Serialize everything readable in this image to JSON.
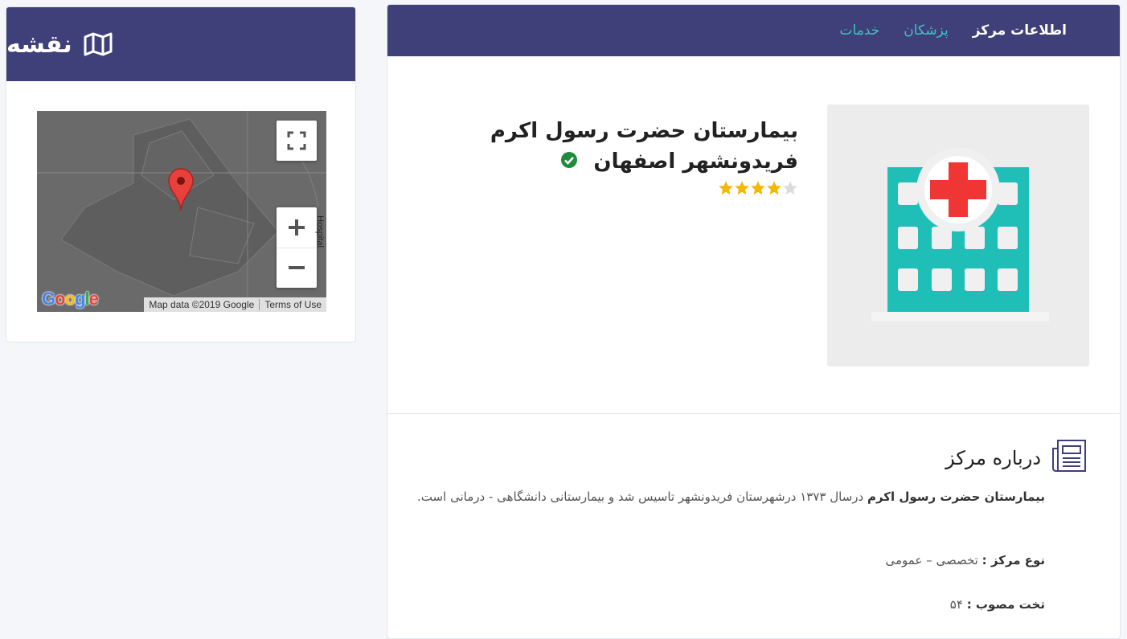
{
  "map_card": {
    "title": "نقشه",
    "attribution": "Map data ©2019 Google",
    "terms": "Terms of Use",
    "road_label": "Hospital",
    "google_logo": "Google"
  },
  "tabs": [
    {
      "label": "اطلاعات مرکز",
      "active": true
    },
    {
      "label": "پزشکان",
      "active": false
    },
    {
      "label": "خدمات",
      "active": false
    }
  ],
  "center": {
    "title": "بیمارستان حضرت رسول اکرم فریدونشهر اصفهان",
    "rating": 4,
    "rating_max": 5
  },
  "about": {
    "heading": "درباره مرکز",
    "name_bold": "بیمارستان حضرت رسول اکرم",
    "description": " درسال ۱۳۷۳ درشهرستان فریدونشهر تاسیس شد و بیمارستانی دانشگاهی - درمانی است.",
    "type_label": "نوع مرکز :",
    "type_value": " تخصصی – عمومی",
    "beds_label": "تخت مصوب :",
    "beds_value": " ۵۴"
  },
  "colors": {
    "header": "#3f3f7a",
    "tab_link": "#3ec5c0",
    "building": "#1fbfb8",
    "cross": "#f03535",
    "star": "#f5b800",
    "verified": "#1e8c3a"
  }
}
